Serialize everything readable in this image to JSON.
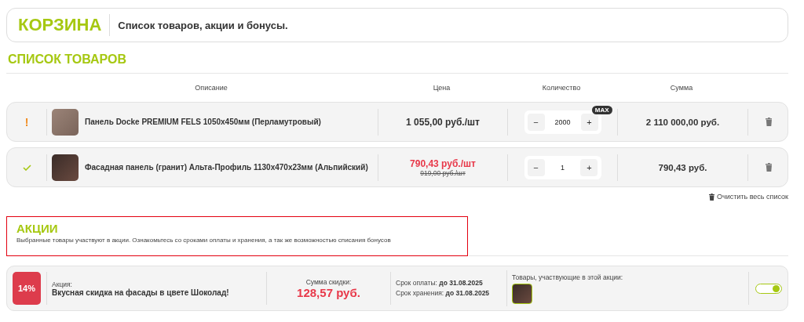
{
  "header": {
    "title": "КОРЗИНА",
    "subtitle": "Список товаров, акции и бонусы."
  },
  "products": {
    "title": "СПИСОК ТОВАРОВ",
    "columns": [
      "Описание",
      "Цена",
      "Количество",
      "Сумма"
    ],
    "rows": [
      {
        "kind": "warning",
        "status_mark": "!",
        "name": "Панель Docke PREMIUM FELS 1050x450мм (Перламутровый)",
        "price": "1 055,00 руб./шт",
        "quantity": "2000",
        "max_badge": "MAX",
        "minus": "−",
        "plus": "+",
        "sum": "2 110 000,00 руб."
      },
      {
        "kind": "ok",
        "name": "Фасадная панель (гранит) Альта-Профиль 1130x470x23мм (Альпийский)",
        "price": "790,43 руб./шт",
        "old_price": "919,00 руб./шт",
        "quantity": "1",
        "minus": "−",
        "plus": "+",
        "sum": "790,43 руб."
      }
    ],
    "clear_label": "Очистить весь список"
  },
  "promotions": {
    "title": "АКЦИИ",
    "description": "Выбранные товары участвуют в акции. Ознакомьтесь со сроками оплаты и хранения, а так же возможностью списания бонусов",
    "items": [
      {
        "percent": "14%",
        "label": "Акция:",
        "name": "Вкусная скидка на фасады в цвете Шоколад!",
        "discount_label": "Сумма скидки:",
        "discount_value": "128,57 руб.",
        "payment_label": "Срок оплаты:",
        "payment_date": "до 31.08.2025",
        "storage_label": "Срок хранения:",
        "storage_date": "до 31.08.2025",
        "products_label": "Товары, участвующие в этой акции:",
        "on": true
      }
    ]
  }
}
